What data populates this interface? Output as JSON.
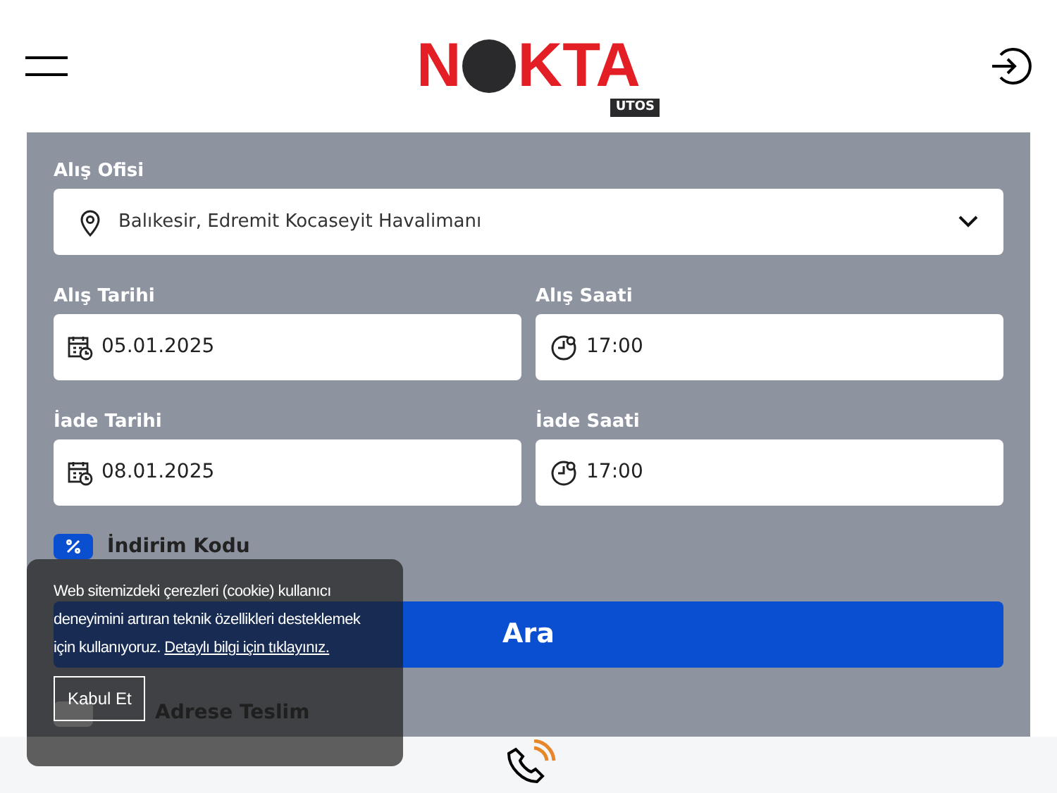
{
  "logo": {
    "left": "N",
    "right": "KTA",
    "badge": "UTOS"
  },
  "form": {
    "pickup_office": {
      "label": "Alış Ofisi",
      "value": "Balıkesir, Edremit Kocaseyit Havalimanı"
    },
    "rows": [
      {
        "date_label": "Alış Tarihi",
        "date": "05.01.2025",
        "time_label": "Alış Saati",
        "time": "17:00"
      },
      {
        "date_label": "İade Tarihi",
        "date": "08.01.2025",
        "time_label": "İade Saati",
        "time": "17:00"
      }
    ],
    "discount": {
      "label": "İndirim Kodu",
      "checked": true
    },
    "search_button": "Ara",
    "different_address": {
      "label": "Adrese Teslim",
      "checked": false
    }
  },
  "cookie_notice": {
    "text": "Web sitemizdeki çerezleri (cookie) kullanıcı deneyimini artıran teknik özellikleri desteklemek için kullanıyoruz.",
    "link": "Detaylı bilgi için tıklayınız.",
    "button": "Kabul Et"
  }
}
